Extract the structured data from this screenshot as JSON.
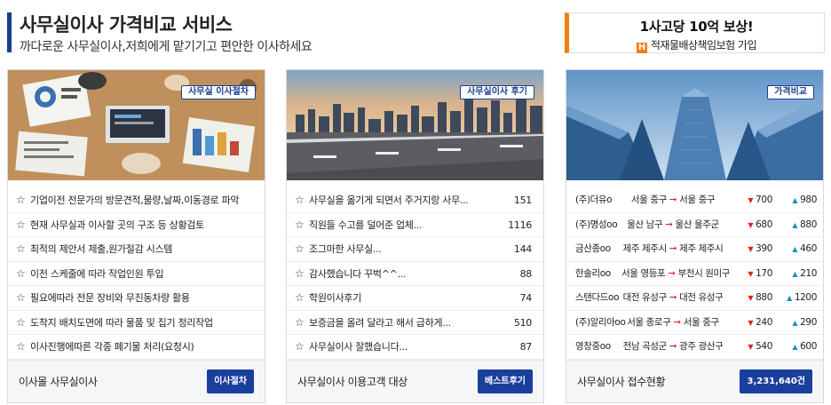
{
  "header": {
    "title": "사무실이사 가격비교 서비스",
    "subtitle": "까다로운 사무실이사,저희에게 맡기기고 편안한 이사하세요"
  },
  "promo": {
    "line1": "1사고당 10억 보상!",
    "logo": "H",
    "line2": "적재물배상책임보험 가입",
    "accent_color": "#f07d12"
  },
  "cards": [
    {
      "tag": "사무실 이사절차",
      "items": [
        "기업이전 전문가의 방문견적,물량,날짜,이동경로 파악",
        "현재 사무실과 이사할 곳의 구조 등 상황검토",
        "최적의 제안서 제출,원가절감 시스템",
        "이전 스케줄에 따라 작업인원 투입",
        "필요에따라 전문 장비와 무진동차량 활용",
        "도착지 배치도면에 따라 물품 및 집기 정리작업",
        "이사진행에따른 각종 폐기물 처리(요청시)"
      ],
      "footer_label": "이사몰 사무실이사",
      "button": "이사절차"
    },
    {
      "tag": "사무실이사 후기",
      "items": [
        {
          "text": "사무실을 옮기게 되면서 주거지랑 사무...",
          "count": "151"
        },
        {
          "text": "직원들 수고를 덜어준 업체...",
          "count": "1116"
        },
        {
          "text": "조그마한 사무실...",
          "count": "144"
        },
        {
          "text": "감사했습니다 꾸벅^^...",
          "count": "88"
        },
        {
          "text": "학원이사후기",
          "count": "74"
        },
        {
          "text": "보증금을 올려 달라고 해서 급하게...",
          "count": "510"
        },
        {
          "text": "사무실이사 잘했습니다...",
          "count": "87"
        }
      ],
      "footer_label": "사무실이사 이용고객 대상",
      "button": "베스트후기"
    },
    {
      "tag": "가격비교",
      "rows": [
        {
          "company": "(주)더유o",
          "from": "서울 중구",
          "to": "서울 중구",
          "low": "700",
          "high": "980"
        },
        {
          "company": "(주)명성oo",
          "from": "울산 남구",
          "to": "울산 울주군",
          "low": "680",
          "high": "880"
        },
        {
          "company": "금산종oo",
          "from": "제주 제주시",
          "to": "제주 제주시",
          "low": "390",
          "high": "460"
        },
        {
          "company": "한솔리oo",
          "from": "서울 영등포",
          "to": "부천시 원미구",
          "low": "170",
          "high": "210"
        },
        {
          "company": "스탠다드oo",
          "from": "대전 유성구",
          "to": "대전 유성구",
          "low": "880",
          "high": "1200"
        },
        {
          "company": "(주)알리아oo",
          "from": "서울 종로구",
          "to": "서울 중구",
          "low": "240",
          "high": "290"
        },
        {
          "company": "영창중oo",
          "from": "전남 곡성군",
          "to": "광주 광산구",
          "low": "540",
          "high": "600"
        }
      ],
      "footer_label": "사무실이사 접수현황",
      "button": "3,231,640건"
    }
  ],
  "icons": {
    "list_bullet": "star-outline-icon",
    "route_arrow": "right-arrow-icon",
    "down": "triangle-down-icon",
    "up": "triangle-up-icon"
  },
  "colors": {
    "brand": "#1a3f9c",
    "down": "#e02020",
    "up": "#1a8fc4"
  }
}
